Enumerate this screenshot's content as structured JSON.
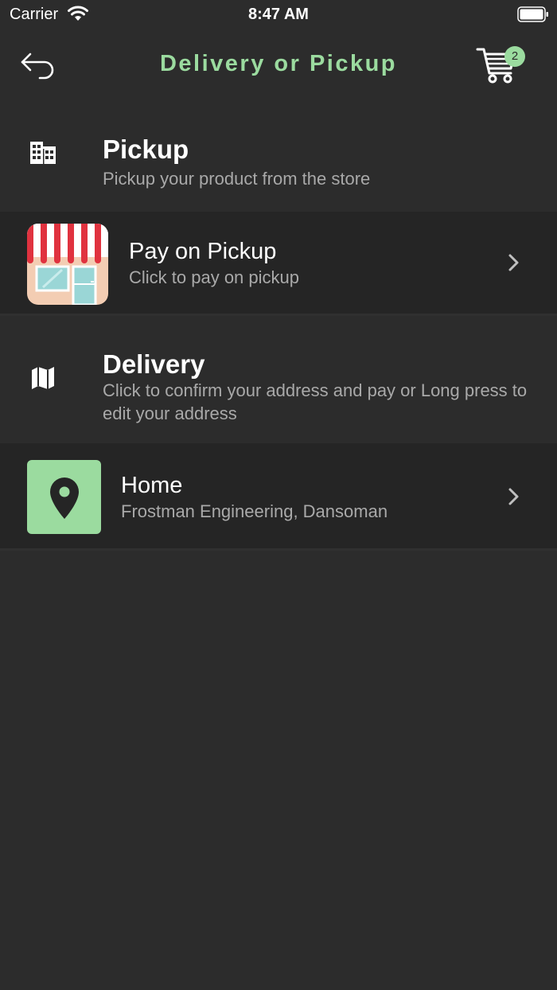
{
  "status_bar": {
    "carrier": "Carrier",
    "time": "8:47 AM"
  },
  "nav": {
    "title": "Delivery or Pickup",
    "cart_count": "2"
  },
  "pickup_section": {
    "title": "Pickup",
    "description": "Pickup your product from the store",
    "icon": "building-icon"
  },
  "pickup_option": {
    "title": "Pay on Pickup",
    "subtitle": "Click to pay on pickup",
    "icon": "storefront-icon"
  },
  "delivery_section": {
    "title": "Delivery",
    "description": "Click to confirm your address and pay or Long press to edit your address",
    "icon": "map-icon"
  },
  "delivery_option": {
    "title": "Home",
    "subtitle": "Frostman Engineering, Dansoman",
    "icon": "location-pin-icon"
  },
  "colors": {
    "background": "#2c2c2c",
    "row_background": "#252525",
    "accent": "#9bdb9f",
    "muted_text": "#a9a9a9"
  }
}
